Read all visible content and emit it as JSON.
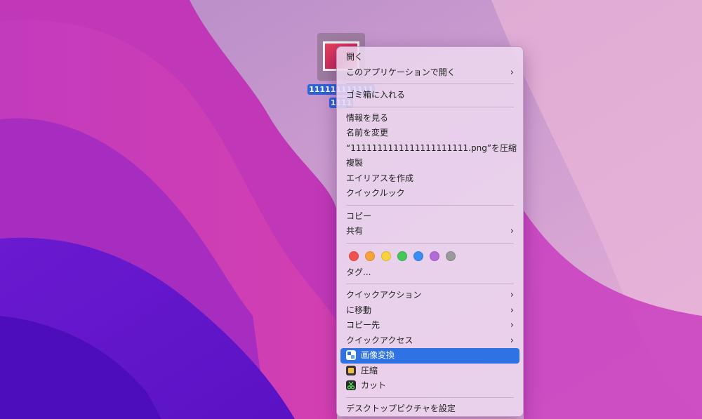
{
  "desktop": {
    "file_name_line1": "111111111111",
    "file_name_line2": "1111"
  },
  "menu": {
    "open": "開く",
    "open_with": "このアプリケーションで開く",
    "move_to_trash": "ゴミ箱に入れる",
    "get_info": "情報を見る",
    "rename": "名前を変更",
    "compress": "“1111111111111111111111.png”を圧縮",
    "duplicate": "複製",
    "make_alias": "エイリアスを作成",
    "quick_look": "クイックルック",
    "copy": "コピー",
    "share": "共有",
    "tags_label": "タグ...",
    "quick_actions": "クイックアクション",
    "move_to": "に移動",
    "copy_to": "コピー先",
    "quick_access": "クイックアクセス",
    "image_convert": "画像変換",
    "compress_app": "圧縮",
    "cut": "カット",
    "set_desktop_picture": "デスクトップピクチャを設定",
    "chevron": "›"
  },
  "tag_colors": [
    "#f0524e",
    "#f5a23a",
    "#f7d23c",
    "#44c659",
    "#3b8df2",
    "#b36ad6",
    "#9a9a9a"
  ],
  "colors": {
    "selection": "#2f72e3",
    "wallpaper_primary": "#c030b8",
    "wallpaper_deep": "#5a10c8"
  }
}
